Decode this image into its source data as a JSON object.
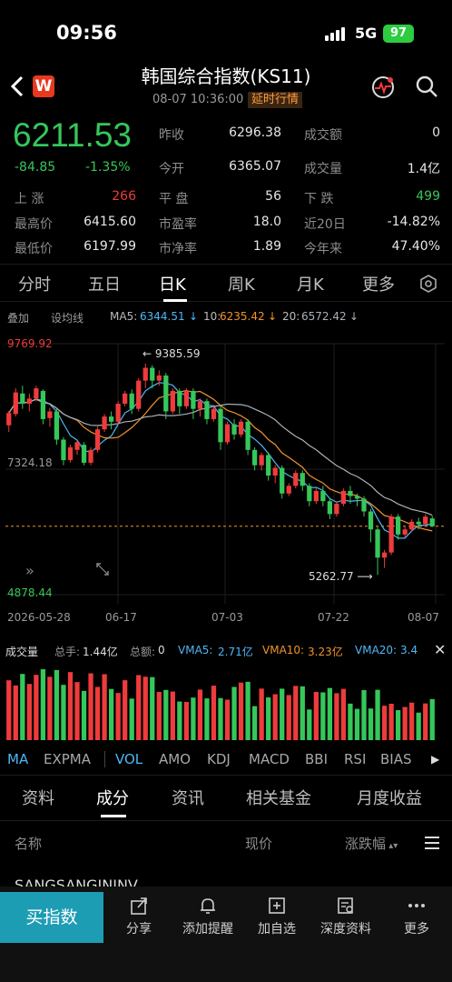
{
  "status_bar": {
    "time": "09:56",
    "network": "5G",
    "battery": "97"
  },
  "header": {
    "logo": "W",
    "title": "韩国综合指数(KS11)",
    "datetime": "08-07 10:36:00",
    "live_badge": "延时行情",
    "icons": [
      "back-icon",
      "pulse-icon",
      "search-icon"
    ]
  },
  "quote": {
    "price": "6211.53",
    "change": "-84.85",
    "change_pct": "-1.35%",
    "fields": [
      {
        "label": "昨收",
        "value": "6296.38"
      },
      {
        "label": "成交额",
        "value": "0"
      },
      {
        "label": "今开",
        "value": "6365.07"
      },
      {
        "label": "成交量",
        "value": "1.4亿"
      }
    ],
    "stats": [
      {
        "label": "上  涨",
        "value": "266"
      },
      {
        "label": "平  盘",
        "value": "56"
      },
      {
        "label": "下  跌",
        "value": "499"
      },
      {
        "label": "最高价",
        "value": "6415.60"
      },
      {
        "label": "市盈率",
        "value": "18.0"
      },
      {
        "label": "近20日",
        "value": "-14.82%"
      },
      {
        "label": "最低价",
        "value": "6197.99"
      },
      {
        "label": "市净率",
        "value": "1.89"
      },
      {
        "label": "今年来",
        "value": "47.40%"
      }
    ]
  },
  "period_tabs": [
    "分时",
    "五日",
    "日K",
    "周K",
    "月K",
    "更多"
  ],
  "active_period": "日K",
  "ma_bar": {
    "overlay": "叠加",
    "config": "设均线",
    "ma5_label": "MA5:",
    "ma5_value": "6344.51",
    "ma10_label": "10:",
    "ma10_value": "6235.42",
    "ma20_label": "20:",
    "ma20_value": "6572.42"
  },
  "chart_data": {
    "type": "candlestick",
    "y_max_label": "9769.92",
    "y_mid_label": "7324.18",
    "y_min_label": "4878.44",
    "ylim": [
      4878.44,
      9769.92
    ],
    "dates": [
      "2026-05-28",
      "06-17",
      "07-03",
      "07-22",
      "08-07"
    ],
    "high_annotation": "9385.59",
    "low_annotation": "5262.77",
    "candles": [
      [
        8180,
        8420,
        8050,
        8460
      ],
      [
        8400,
        8820,
        8350,
        8900
      ],
      [
        8800,
        8600,
        8500,
        8950
      ],
      [
        8600,
        8700,
        8450,
        8800
      ],
      [
        8700,
        8900,
        8650,
        8950
      ],
      [
        8850,
        8300,
        8200,
        8880
      ],
      [
        8320,
        8450,
        8150,
        8520
      ],
      [
        8450,
        7900,
        7800,
        8500
      ],
      [
        7900,
        7500,
        7400,
        7950
      ],
      [
        7500,
        7750,
        7450,
        7800
      ],
      [
        7700,
        7850,
        7600,
        7880
      ],
      [
        7800,
        7450,
        7400,
        7850
      ],
      [
        7450,
        7700,
        7400,
        7750
      ],
      [
        7700,
        8100,
        7650,
        8150
      ],
      [
        8100,
        8350,
        8050,
        8400
      ],
      [
        8350,
        8250,
        8100,
        8450
      ],
      [
        8250,
        8600,
        8200,
        8650
      ],
      [
        8600,
        8800,
        8550,
        8850
      ],
      [
        8800,
        8500,
        8400,
        8880
      ],
      [
        8500,
        9050,
        8450,
        9100
      ],
      [
        9050,
        9300,
        8900,
        9385
      ],
      [
        9300,
        9050,
        8900,
        9350
      ],
      [
        9050,
        9150,
        8950,
        9250
      ],
      [
        9150,
        8450,
        8300,
        9200
      ],
      [
        8450,
        8850,
        8400,
        8900
      ],
      [
        8850,
        8550,
        8400,
        8900
      ],
      [
        8550,
        8850,
        8500,
        8900
      ],
      [
        8850,
        8500,
        8300,
        8900
      ],
      [
        8500,
        8650,
        8350,
        8700
      ],
      [
        8650,
        8300,
        8200,
        8700
      ],
      [
        8300,
        8500,
        8250,
        8550
      ],
      [
        8500,
        7850,
        7700,
        8550
      ],
      [
        7850,
        8200,
        7800,
        8250
      ],
      [
        8200,
        8000,
        7900,
        8300
      ],
      [
        8000,
        8250,
        7950,
        8300
      ],
      [
        8250,
        7700,
        7600,
        8300
      ],
      [
        7700,
        7400,
        7300,
        7750
      ],
      [
        7400,
        7600,
        7300,
        7650
      ],
      [
        7600,
        7200,
        7100,
        7650
      ],
      [
        7200,
        7350,
        7050,
        7400
      ],
      [
        7350,
        6850,
        6750,
        7400
      ],
      [
        6850,
        7000,
        6800,
        7050
      ],
      [
        7000,
        7250,
        6950,
        7300
      ],
      [
        7250,
        7000,
        6900,
        7300
      ],
      [
        7000,
        6700,
        6600,
        7050
      ],
      [
        6700,
        6900,
        6650,
        6950
      ],
      [
        6900,
        6700,
        6600,
        7000
      ],
      [
        6700,
        6450,
        6350,
        6750
      ],
      [
        6450,
        6650,
        6400,
        6700
      ],
      [
        6650,
        6900,
        6600,
        6950
      ],
      [
        6900,
        6800,
        6650,
        7000
      ],
      [
        6800,
        6750,
        6600,
        6850
      ],
      [
        6750,
        6500,
        6400,
        6800
      ],
      [
        6500,
        6150,
        5900,
        6550
      ],
      [
        6150,
        5600,
        5263,
        6200
      ],
      [
        5600,
        5700,
        5400,
        5750
      ],
      [
        5700,
        6400,
        5650,
        6450
      ],
      [
        6400,
        6050,
        5950,
        6450
      ],
      [
        6050,
        6150,
        6000,
        6200
      ],
      [
        6150,
        6300,
        6100,
        6350
      ],
      [
        6300,
        6250,
        6150,
        6380
      ],
      [
        6250,
        6400,
        6200,
        6450
      ],
      [
        6365,
        6211,
        6198,
        6416
      ]
    ],
    "volume_title": "成交量",
    "volume_total_label": "总手:",
    "volume_total": "1.44亿",
    "amount_label": "总额:",
    "amount_value": "0",
    "vma5_label": "VMA5:",
    "vma5": "2.71亿",
    "vma10_label": "VMA10:",
    "vma10": "3.23亿",
    "vma20_label": "VMA20:",
    "vma20": "3.4"
  },
  "indicator_tabs": [
    "MA",
    "EXPMA",
    "VOL",
    "AMO",
    "KDJ",
    "MACD",
    "BBI",
    "RSI",
    "BIAS"
  ],
  "section_tabs": [
    "资料",
    "成分",
    "资讯",
    "相关基金",
    "月度收益"
  ],
  "active_section": "成分",
  "table_head": {
    "name": "名称",
    "price": "现价",
    "change": "涨跌幅"
  },
  "table_first_row": "SANGSANGININV",
  "colors": {
    "up": "#ee3b3b",
    "down": "#35c75a",
    "accent": "#1d9db4",
    "ma5": "#4fb6f5",
    "ma10": "#f0932b",
    "ma20": "#aab0b8"
  },
  "bottom_actions": [
    {
      "label": "分享",
      "icon": "share-icon"
    },
    {
      "label": "添加提醒",
      "icon": "bell-icon"
    },
    {
      "label": "加自选",
      "icon": "add-watchlist-icon"
    },
    {
      "label": "深度资料",
      "icon": "report-icon"
    },
    {
      "label": "更多",
      "icon": "more-icon"
    }
  ],
  "buy_button": "买指数"
}
